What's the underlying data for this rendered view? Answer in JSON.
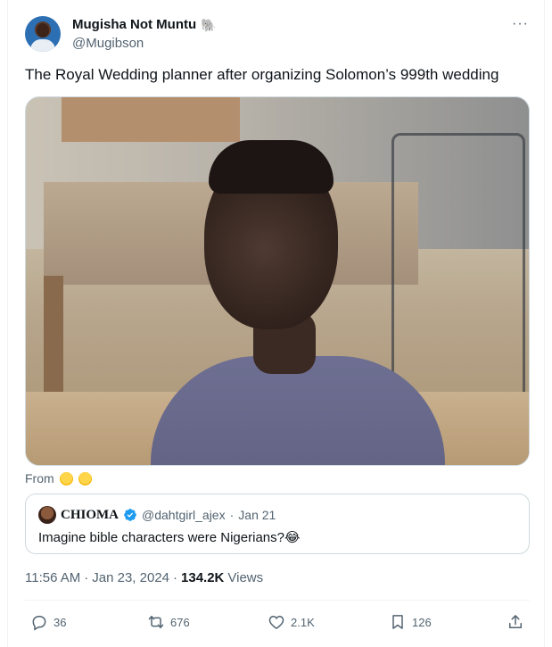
{
  "author": {
    "display_name": "Mugisha Not Muntu",
    "name_emoji": "🐘",
    "handle": "@Mugibson"
  },
  "tweet": {
    "text": "The Royal Wedding planner after organizing Solomon’s 999th wedding",
    "from_label": "From",
    "from_emojis": [
      "chick-icon",
      "chick-icon"
    ]
  },
  "quote": {
    "name": "CHIOMA",
    "handle": "@dahtgirl_ajex",
    "separator": "·",
    "date": "Jan 21",
    "text": "Imagine bible characters were Nigerians?😂"
  },
  "meta": {
    "time": "11:56 AM",
    "separator1": "·",
    "date": "Jan 23, 2024",
    "separator2": "·",
    "views_count": "134.2K",
    "views_label": "Views"
  },
  "actions": {
    "replies": "36",
    "reposts": "676",
    "likes": "2.1K",
    "bookmarks": "126"
  },
  "colors": {
    "text_primary": "#0f1419",
    "text_secondary": "#536471",
    "border": "#cfd9de",
    "verified_blue": "#1d9bf0",
    "repost_green": "#00ba7c"
  }
}
